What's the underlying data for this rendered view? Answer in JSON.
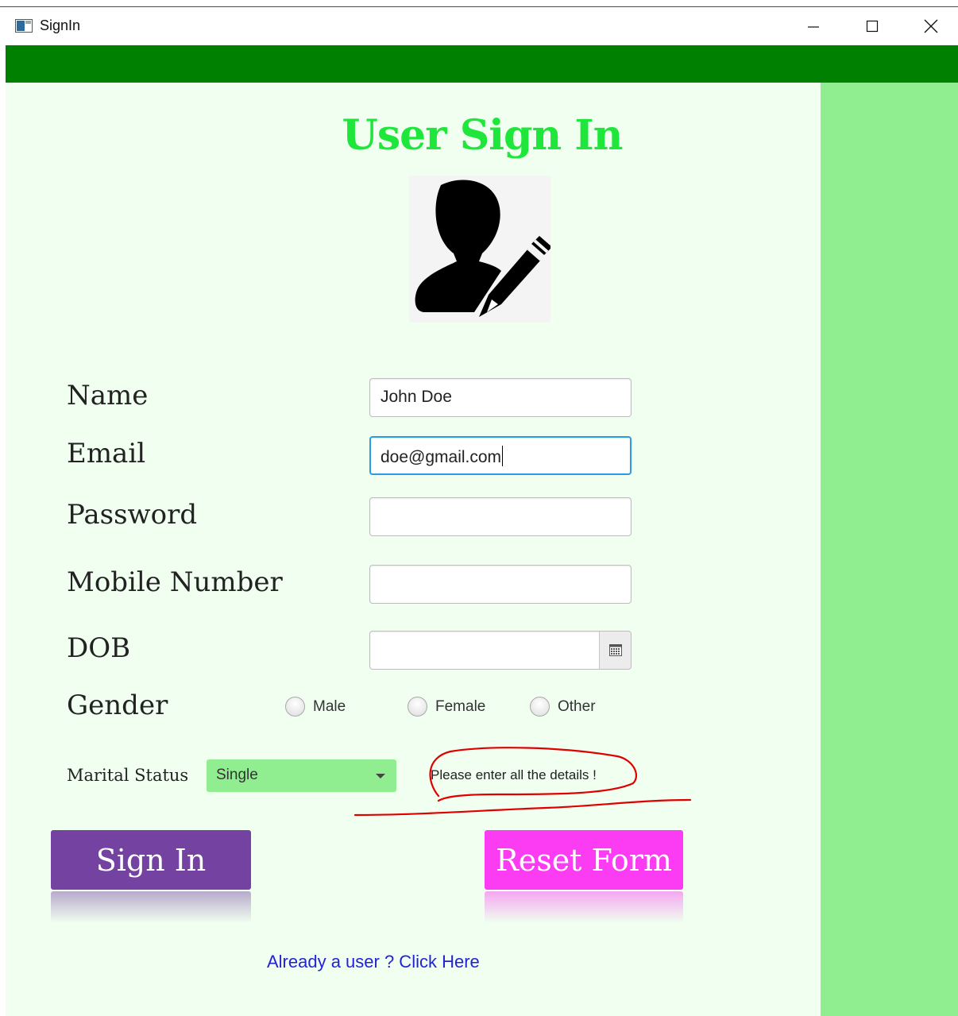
{
  "window": {
    "title": "SignIn",
    "minimize_icon": "minimize-icon",
    "maximize_icon": "maximize-icon",
    "close_icon": "close-icon"
  },
  "colors": {
    "header_bar": "#008000",
    "content_bg": "#f0fff0",
    "sidebar_bg": "#90ee90",
    "title": "#1fe63a",
    "signin_button": "#7442a0",
    "reset_button": "#fb3cf3",
    "link": "#2323d6",
    "focus_border": "#2a9be6",
    "annotation": "#e00000"
  },
  "form": {
    "title": "User Sign In",
    "avatar_icon": "user-edit-icon",
    "name": {
      "label": "Name",
      "value": "John Doe"
    },
    "email": {
      "label": "Email",
      "value": "doe@gmail.com"
    },
    "password": {
      "label": "Password",
      "value": ""
    },
    "mobile": {
      "label": "Mobile Number",
      "value": ""
    },
    "dob": {
      "label": "DOB",
      "value": "",
      "picker_icon": "calendar-icon"
    },
    "gender": {
      "label": "Gender",
      "options": [
        "Male",
        "Female",
        "Other"
      ]
    },
    "marital_status": {
      "label": "Marital Status",
      "selected": "Single"
    },
    "error_message": "Please enter all the details !",
    "signin_label": "Sign In",
    "reset_label": "Reset Form",
    "login_link": "Already a user ? Click Here"
  }
}
